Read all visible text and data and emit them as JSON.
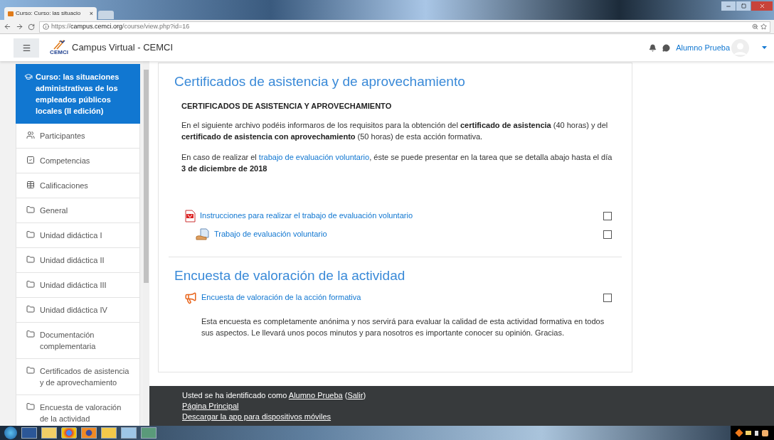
{
  "browser": {
    "tab_title": "Curso: Curso: las situacio",
    "tab_close": "×",
    "url": "https://**campus.cemci.org**/course/view.php?id=16"
  },
  "navbar": {
    "logo_text": "CEMCI",
    "site_name": "Campus Virtual - CEMCI",
    "user_name": "Alumno Prueba"
  },
  "sidebar": {
    "course": {
      "title": "Curso: las situaciones administrativas de los empleados públicos locales (II edición)",
      "selected": true
    },
    "items": [
      {
        "kind": "users",
        "label": "Participantes",
        "selected": false
      },
      {
        "kind": "check",
        "label": "Competencias",
        "selected": false
      },
      {
        "kind": "table",
        "label": "Calificaciones",
        "selected": false
      },
      {
        "kind": "folder",
        "label": "General",
        "selected": false
      },
      {
        "kind": "folder",
        "label": "Unidad didáctica I",
        "selected": false
      },
      {
        "kind": "folder",
        "label": "Unidad didáctica II",
        "selected": false
      },
      {
        "kind": "folder",
        "label": "Unidad didáctica III",
        "selected": false
      },
      {
        "kind": "folder",
        "label": "Unidad didáctica IV",
        "selected": false
      },
      {
        "kind": "folder",
        "label": "Documentación complementaria",
        "selected": false
      },
      {
        "kind": "folder",
        "label": "Certificados de asistencia y de aprovechamiento",
        "selected": false
      },
      {
        "kind": "folder",
        "label": "Encuesta de valoración de la actividad",
        "selected": false
      }
    ]
  },
  "sections": [
    {
      "title": "Certificados de asistencia y de aprovechamiento",
      "heading": "CERTIFICADOS DE ASISTENCIA Y APROVECHAMIENTO",
      "paragraphs": [
        [
          {
            "kind": "text",
            "text": "En el siguiente archivo podéis informaros de los requisitos para la obtención del **certificado de asistencia** (40 horas) y del **certificado de asistencia con aprovechamiento** (50 horas) de esta acción formativa."
          }
        ],
        [
          {
            "kind": "text",
            "text": "En caso de realizar el "
          },
          {
            "kind": "link",
            "text": "trabajo de evaluación voluntario"
          },
          {
            "kind": "text",
            "text": ", éste se puede presentar en la tarea que se detalla abajo hasta el día **3 de diciembre de 2018**"
          }
        ]
      ],
      "activities": [
        {
          "kind": "pdf",
          "label": "Instrucciones para realizar el trabajo de evaluación voluntario",
          "indented": false,
          "checked": false
        },
        {
          "kind": "assign",
          "label": "Trabajo de evaluación voluntario",
          "indented": true,
          "checked": false
        }
      ]
    },
    {
      "title": "Encuesta de valoración de la actividad",
      "activities": [
        {
          "kind": "feedback",
          "label": "Encuesta de valoración de la acción formativa",
          "indented": false,
          "checked": false,
          "description": "Esta encuesta es completamente anónima y nos servirá para evaluar la calidad de esta actividad formativa en todos sus aspectos. Le llevará unos pocos minutos y para nosotros es importante conocer su opinión. Gracias."
        }
      ]
    }
  ],
  "footer": {
    "lines": [
      [
        {
          "kind": "text",
          "text": "Usted se ha identificado como "
        },
        {
          "kind": "link",
          "text": "Alumno Prueba"
        },
        {
          "kind": "text",
          "text": " ("
        },
        {
          "kind": "link",
          "text": "Salir"
        },
        {
          "kind": "text",
          "text": ")"
        }
      ],
      [
        {
          "kind": "link",
          "text": "Página Principal"
        }
      ],
      [
        {
          "kind": "link",
          "text": "Descargar la app para dispositivos móviles"
        }
      ]
    ]
  }
}
